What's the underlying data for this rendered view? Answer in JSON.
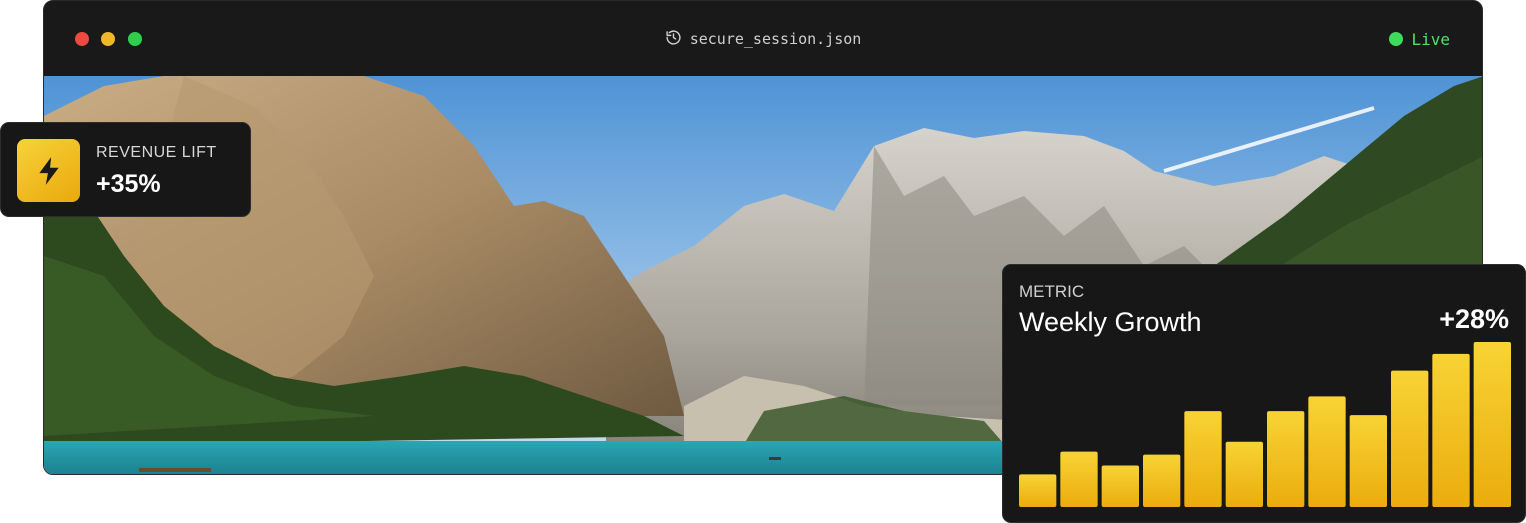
{
  "window": {
    "title": "secure_session.json",
    "status": "Live",
    "icons": {
      "title": "history-icon",
      "status": "live-indicator-dot"
    }
  },
  "revenue_card": {
    "label": "REVENUE LIFT",
    "value": "+35%",
    "icon": "lightning-bolt-icon"
  },
  "metric_card": {
    "label": "METRIC",
    "title": "Weekly Growth",
    "value": "+28%"
  },
  "chart_data": {
    "type": "bar",
    "categories": [
      "",
      "",
      "",
      "",
      "",
      "",
      "",
      "",
      "",
      "",
      "",
      ""
    ],
    "values": [
      33,
      56,
      42,
      53,
      97,
      66,
      97,
      112,
      93,
      138,
      155,
      167
    ],
    "ylim": [
      0,
      170
    ],
    "grid": false
  },
  "colors": {
    "accent_top": "#f8d335",
    "accent_bottom": "#ebac0d",
    "live_green": "#3ddc5c",
    "window_bg": "#191919"
  }
}
